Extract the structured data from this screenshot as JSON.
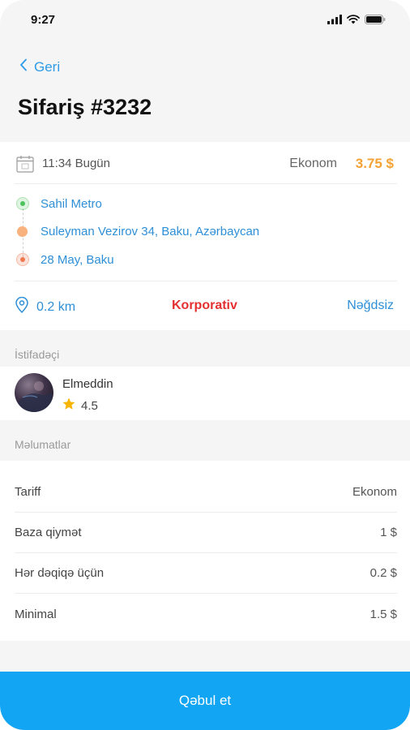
{
  "status_bar": {
    "time": "9:27",
    "icons": [
      "signal-icon",
      "wifi-icon",
      "battery-icon"
    ]
  },
  "header": {
    "back_label": "Geri",
    "title": "Sifariş #3232"
  },
  "order": {
    "time": "11:34 Bugün",
    "class": "Ekonom",
    "price": "3.75 $",
    "route": [
      {
        "label": "Sahil Metro",
        "color": "#4cc35c"
      },
      {
        "label": "Suleyman Vezirov 34, Baku, Azərbaycan",
        "color": "#f4a45f"
      },
      {
        "label": "28 May, Baku",
        "color": "#f07a50"
      }
    ],
    "distance": "0.2 km",
    "corporate_label": "Korporativ",
    "payment": "Nəğdsiz"
  },
  "user_section": {
    "header": "İstifadəçi",
    "name": "Elmeddin",
    "rating": "4.5"
  },
  "info_section": {
    "header": "Məlumatlar",
    "rows": [
      {
        "label": "Tariff",
        "value": "Ekonom"
      },
      {
        "label": "Baza qiymət",
        "value": "1 $"
      },
      {
        "label": "Hər dəqiqə üçün",
        "value": "0.2 $"
      },
      {
        "label": "Minimal",
        "value": "1.5 $"
      }
    ]
  },
  "actions": {
    "accept_label": "Qəbul et"
  },
  "colors": {
    "accent": "#12a5f4",
    "link": "#2e8fd6",
    "price": "#f4a232",
    "corporate": "#e53030",
    "star": "#f7b500"
  }
}
